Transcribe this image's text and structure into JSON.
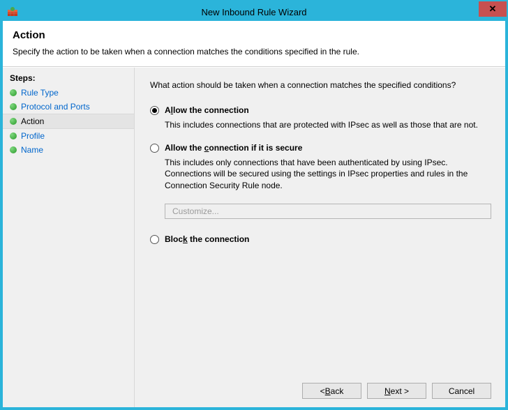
{
  "titlebar": {
    "title": "New Inbound Rule Wizard"
  },
  "header": {
    "title": "Action",
    "subtitle": "Specify the action to be taken when a connection matches the conditions specified in the rule."
  },
  "sidebar": {
    "steps_label": "Steps:",
    "items": [
      {
        "label": "Rule Type",
        "active": false
      },
      {
        "label": "Protocol and Ports",
        "active": false
      },
      {
        "label": "Action",
        "active": true
      },
      {
        "label": "Profile",
        "active": false
      },
      {
        "label": "Name",
        "active": false
      }
    ]
  },
  "content": {
    "question": "What action should be taken when a connection matches the specified conditions?",
    "options": {
      "allow": {
        "label_pre": "A",
        "label_ul": "l",
        "label_post": "low the connection",
        "desc": "This includes connections that are protected with IPsec as well as those that are not.",
        "selected": true
      },
      "allow_secure": {
        "label_pre": "Allow the ",
        "label_ul": "c",
        "label_post": "onnection if it is secure",
        "desc": "This includes only connections that have been authenticated by using IPsec. Connections will be secured using the settings in IPsec properties and rules in the Connection Security Rule node.",
        "customize_label": "Customize...",
        "selected": false
      },
      "block": {
        "label_pre": "Bloc",
        "label_ul": "k",
        "label_post": " the connection",
        "selected": false
      }
    }
  },
  "buttons": {
    "back_pre": "< ",
    "back_ul": "B",
    "back_post": "ack",
    "next_ul": "N",
    "next_post": "ext >",
    "cancel": "Cancel"
  }
}
